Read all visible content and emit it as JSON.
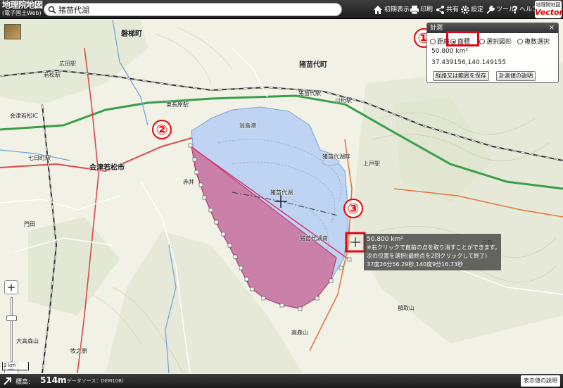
{
  "header": {
    "logo_main": "地理院地図",
    "logo_sub": "(電子国土Web)",
    "search_value": "猪苗代湖",
    "buttons": [
      {
        "label": "初期表示",
        "icon": "home-icon"
      },
      {
        "label": "印刷",
        "icon": "printer-icon"
      },
      {
        "label": "共有",
        "icon": "share-icon"
      },
      {
        "label": "設定",
        "icon": "gear-icon"
      },
      {
        "label": "ツール",
        "icon": "tools-icon"
      },
      {
        "label": "ヘルプ",
        "icon": "help-icon"
      }
    ],
    "brand_top": "地理院地図",
    "brand_bottom": "Vector"
  },
  "measure": {
    "title": "計測",
    "close": "×",
    "options": [
      "距離",
      "面積",
      "選択図形",
      "複数選択"
    ],
    "selected": "面積",
    "result": "50.800 km²",
    "coords": "37.439156,140.149155",
    "btn_save": "経路又は範囲を保存",
    "btn_help": "計測値の説明"
  },
  "tooltip": {
    "area": "50.800 km²",
    "line1": "※右クリックで直前の点を取り消すことができます。",
    "line2": "次の位置を選択(最終点を2回クリックして終了)",
    "line3": "37度26分56.29秒,140度9分16.73秒"
  },
  "annotations": [
    "①",
    "②",
    "③"
  ],
  "zoom": {
    "plus": "+",
    "minus": "−"
  },
  "scale": "3 km",
  "footer": {
    "elev_label": "標高:",
    "elev_value": "514m",
    "elev_source": "(データソース：DEM10B)",
    "elev_help": "表示値の説明"
  },
  "map_labels": [
    {
      "text": "磐梯町",
      "cls": "big"
    },
    {
      "text": "猪苗代町",
      "cls": "big"
    },
    {
      "text": "猪苗代湖",
      "cls": ""
    },
    {
      "text": "会津若松市",
      "cls": "big"
    },
    {
      "text": "翁島港",
      "cls": ""
    },
    {
      "text": "猪苗代湖南",
      "cls": ""
    },
    {
      "text": "猪苗代湖畔",
      "cls": ""
    },
    {
      "text": "会津若松IC",
      "cls": ""
    },
    {
      "text": "広田駅",
      "cls": ""
    },
    {
      "text": "七日町駅",
      "cls": ""
    },
    {
      "text": "若松駅",
      "cls": ""
    },
    {
      "text": "門田",
      "cls": ""
    },
    {
      "text": "高森山",
      "cls": ""
    },
    {
      "text": "額取山",
      "cls": ""
    },
    {
      "text": "三森",
      "cls": ""
    },
    {
      "text": "大高森山",
      "cls": ""
    },
    {
      "text": "牧之原",
      "cls": ""
    },
    {
      "text": "赤井",
      "cls": ""
    },
    {
      "text": "東長原駅",
      "cls": ""
    },
    {
      "text": "上戸駅",
      "cls": ""
    },
    {
      "text": "猪苗代駅",
      "cls": ""
    },
    {
      "text": "川桁駅",
      "cls": ""
    }
  ]
}
